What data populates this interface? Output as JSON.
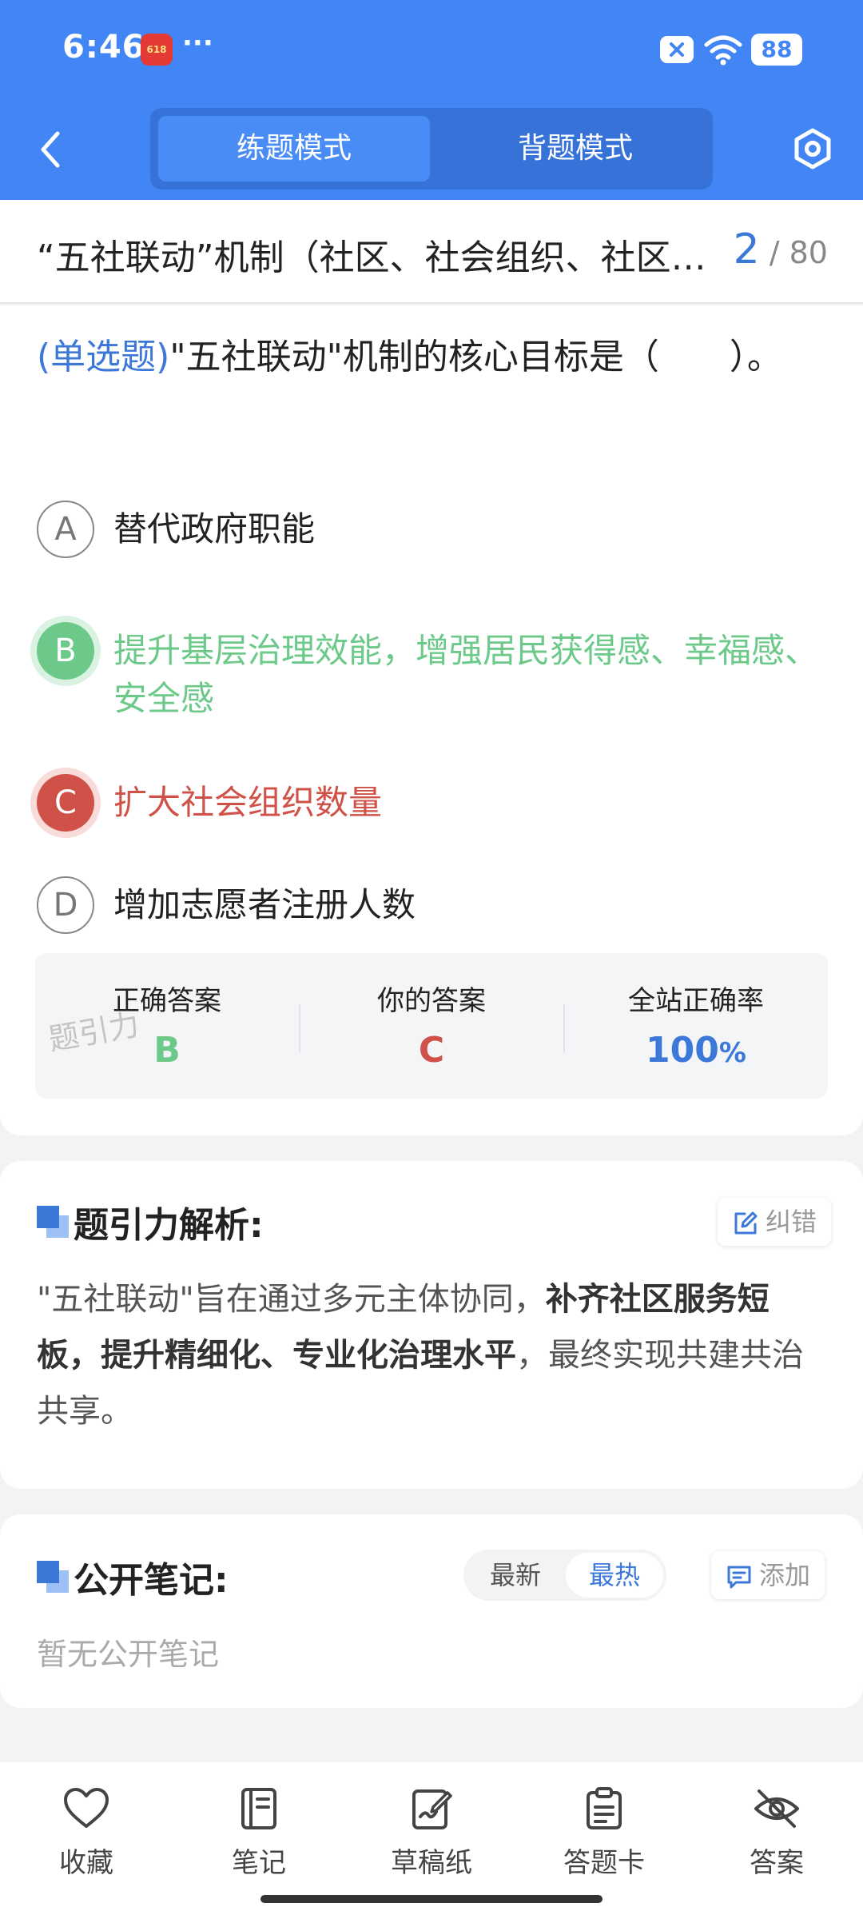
{
  "status_bar": {
    "time": "6:46",
    "app_badge": "618",
    "more": "···",
    "battery": "88"
  },
  "nav": {
    "tabs": [
      {
        "label": "练题模式",
        "active": true
      },
      {
        "label": "背题模式",
        "active": false
      }
    ]
  },
  "title_bar": {
    "title": "“五社联动”机制（社区、社会组织、社区社工、社区志愿者、社会慈善资源）",
    "current": "2",
    "total": "/ 80"
  },
  "question": {
    "type": "(单选题)",
    "text": "\"五社联动\"机制的核心目标是（　　）。",
    "options": [
      {
        "letter": "A",
        "text": "替代政府职能",
        "state": "normal"
      },
      {
        "letter": "B",
        "text": "提升基层治理效能，增强居民获得感、幸福感、安全感",
        "state": "correct"
      },
      {
        "letter": "C",
        "text": "扩大社会组织数量",
        "state": "wrong"
      },
      {
        "letter": "D",
        "text": "增加志愿者注册人数",
        "state": "normal"
      }
    ]
  },
  "stats": {
    "correct_label": "正确答案",
    "correct_value": "B",
    "your_label": "你的答案",
    "your_value": "C",
    "rate_label": "全站正确率",
    "rate_value": "100",
    "rate_unit": "%",
    "watermark": "题引力"
  },
  "analysis": {
    "title": "题引力解析:",
    "report_label": "纠错",
    "text_1": "\"五社联动\"旨在通过多元主体协同，",
    "text_bold_1": "补齐社区服务短板，提升精细化、专业化治理水平",
    "text_2": "，最终实现共建共治共享。"
  },
  "notes": {
    "title": "公开笔记:",
    "sort_latest": "最新",
    "sort_hot": "最热",
    "add_label": "添加",
    "empty": "暂无公开笔记"
  },
  "bottom_tabs": [
    {
      "label": "收藏",
      "icon": "heart-icon"
    },
    {
      "label": "笔记",
      "icon": "notebook-icon"
    },
    {
      "label": "草稿纸",
      "icon": "draft-icon"
    },
    {
      "label": "答题卡",
      "icon": "clipboard-icon"
    },
    {
      "label": "答案",
      "icon": "eye-off-icon"
    }
  ],
  "colors": {
    "primary": "#4285f4",
    "correct": "#6cc98a",
    "wrong": "#cf5148",
    "accent": "#3c78d8"
  }
}
